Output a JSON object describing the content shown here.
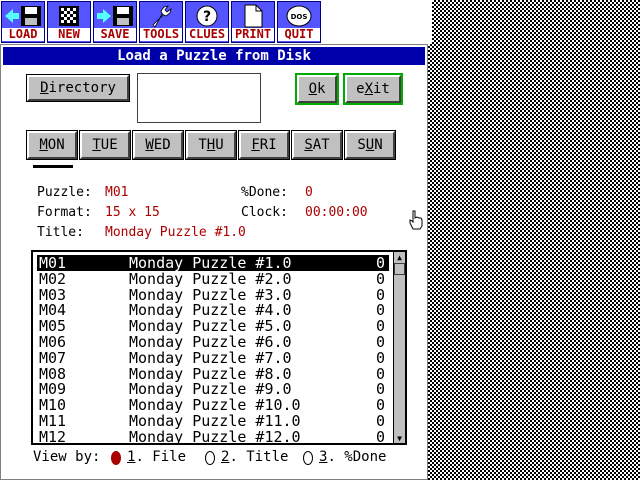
{
  "toolbar": {
    "buttons": [
      {
        "label": "LOAD",
        "icon": "floppy-load-icon"
      },
      {
        "label": "NEW",
        "icon": "grid-icon"
      },
      {
        "label": "SAVE",
        "icon": "floppy-save-icon"
      },
      {
        "label": "TOOLS",
        "icon": "wrench-icon"
      },
      {
        "label": "CLUES",
        "icon": "question-icon"
      },
      {
        "label": "PRINT",
        "icon": "page-icon"
      },
      {
        "label": "QUIT",
        "icon": "dos-icon"
      }
    ],
    "dos_text": "DOS"
  },
  "dialog": {
    "title": "Load a Puzzle from Disk",
    "directory_button": {
      "underlined": "D",
      "rest": "irectory"
    },
    "ok_button": {
      "underlined": "O",
      "rest": "k"
    },
    "exit_button": {
      "pre": "e",
      "underlined": "X",
      "rest": "it"
    },
    "day_tabs": [
      {
        "underlined": "M",
        "rest": "ON"
      },
      {
        "underlined": "T",
        "rest": "UE"
      },
      {
        "underlined": "W",
        "rest": "ED"
      },
      {
        "pre": "T",
        "underlined": "H",
        "rest": "U"
      },
      {
        "underlined": "F",
        "rest": "RI"
      },
      {
        "underlined": "S",
        "rest": "AT"
      },
      {
        "pre": "S",
        "underlined": "U",
        "rest": "N"
      }
    ],
    "info": {
      "puzzle_label": "Puzzle:",
      "puzzle_value": "M01",
      "format_label": "Format:",
      "format_value": "15 x 15",
      "title_label": "Title:",
      "title_value": "Monday Puzzle #1.0",
      "done_label": "%Done:",
      "done_value": "0",
      "clock_label": "Clock:",
      "clock_value": "00:00:00"
    },
    "puzzles": [
      {
        "id": "M01",
        "title": "Monday Puzzle #1.0",
        "done": "0"
      },
      {
        "id": "M02",
        "title": "Monday Puzzle #2.0",
        "done": "0"
      },
      {
        "id": "M03",
        "title": "Monday Puzzle #3.0",
        "done": "0"
      },
      {
        "id": "M04",
        "title": "Monday Puzzle #4.0",
        "done": "0"
      },
      {
        "id": "M05",
        "title": "Monday Puzzle #5.0",
        "done": "0"
      },
      {
        "id": "M06",
        "title": "Monday Puzzle #6.0",
        "done": "0"
      },
      {
        "id": "M07",
        "title": "Monday Puzzle #7.0",
        "done": "0"
      },
      {
        "id": "M08",
        "title": "Monday Puzzle #8.0",
        "done": "0"
      },
      {
        "id": "M09",
        "title": "Monday Puzzle #9.0",
        "done": "0"
      },
      {
        "id": "M10",
        "title": "Monday Puzzle #10.0",
        "done": "0"
      },
      {
        "id": "M11",
        "title": "Monday Puzzle #11.0",
        "done": "0"
      },
      {
        "id": "M12",
        "title": "Monday Puzzle #12.0",
        "done": "0"
      }
    ],
    "view_by": {
      "label": "View by:",
      "options": [
        {
          "num": "1",
          "text": ". File",
          "checked": true
        },
        {
          "num": "2",
          "text": ". Title",
          "checked": false
        },
        {
          "num": "3",
          "text": ". %Done",
          "checked": false
        }
      ]
    }
  },
  "colors": {
    "toolbar_button": "#5555ff",
    "label_red": "#aa0000",
    "title_bar": "#0000aa",
    "button_face": "#c0c0c0",
    "focus_green": "#00aa00"
  }
}
